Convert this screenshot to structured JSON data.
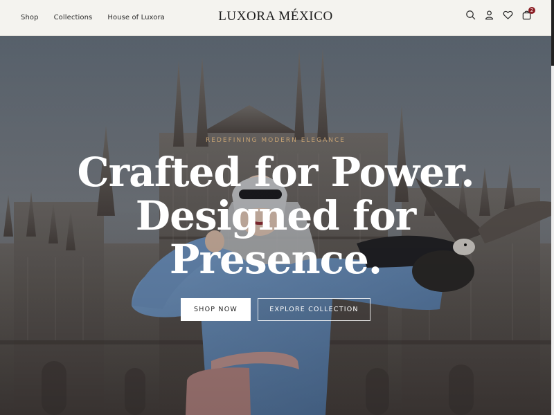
{
  "nav": {
    "items": [
      {
        "label": "Shop"
      },
      {
        "label": "Collections"
      },
      {
        "label": "House of Luxora"
      }
    ]
  },
  "brand": {
    "name": "LUXORA MÉXICO"
  },
  "icons": {
    "search": "search-icon",
    "account": "user-icon",
    "wishlist": "heart-icon",
    "cart": "bag-icon",
    "cart_count": "2"
  },
  "hero": {
    "eyebrow": "REDEFINING MODERN ELEGANCE",
    "headline_line1": "Crafted for Power.",
    "headline_line2": "Designed for",
    "headline_line3": "Presence.",
    "primary_cta": "SHOP NOW",
    "secondary_cta": "EXPLORE COLLECTION"
  },
  "colors": {
    "header_bg": "#f4f3ef",
    "accent_gold": "#c6a274",
    "badge": "#8c1d24",
    "coat_blue": "#6f93c0"
  }
}
